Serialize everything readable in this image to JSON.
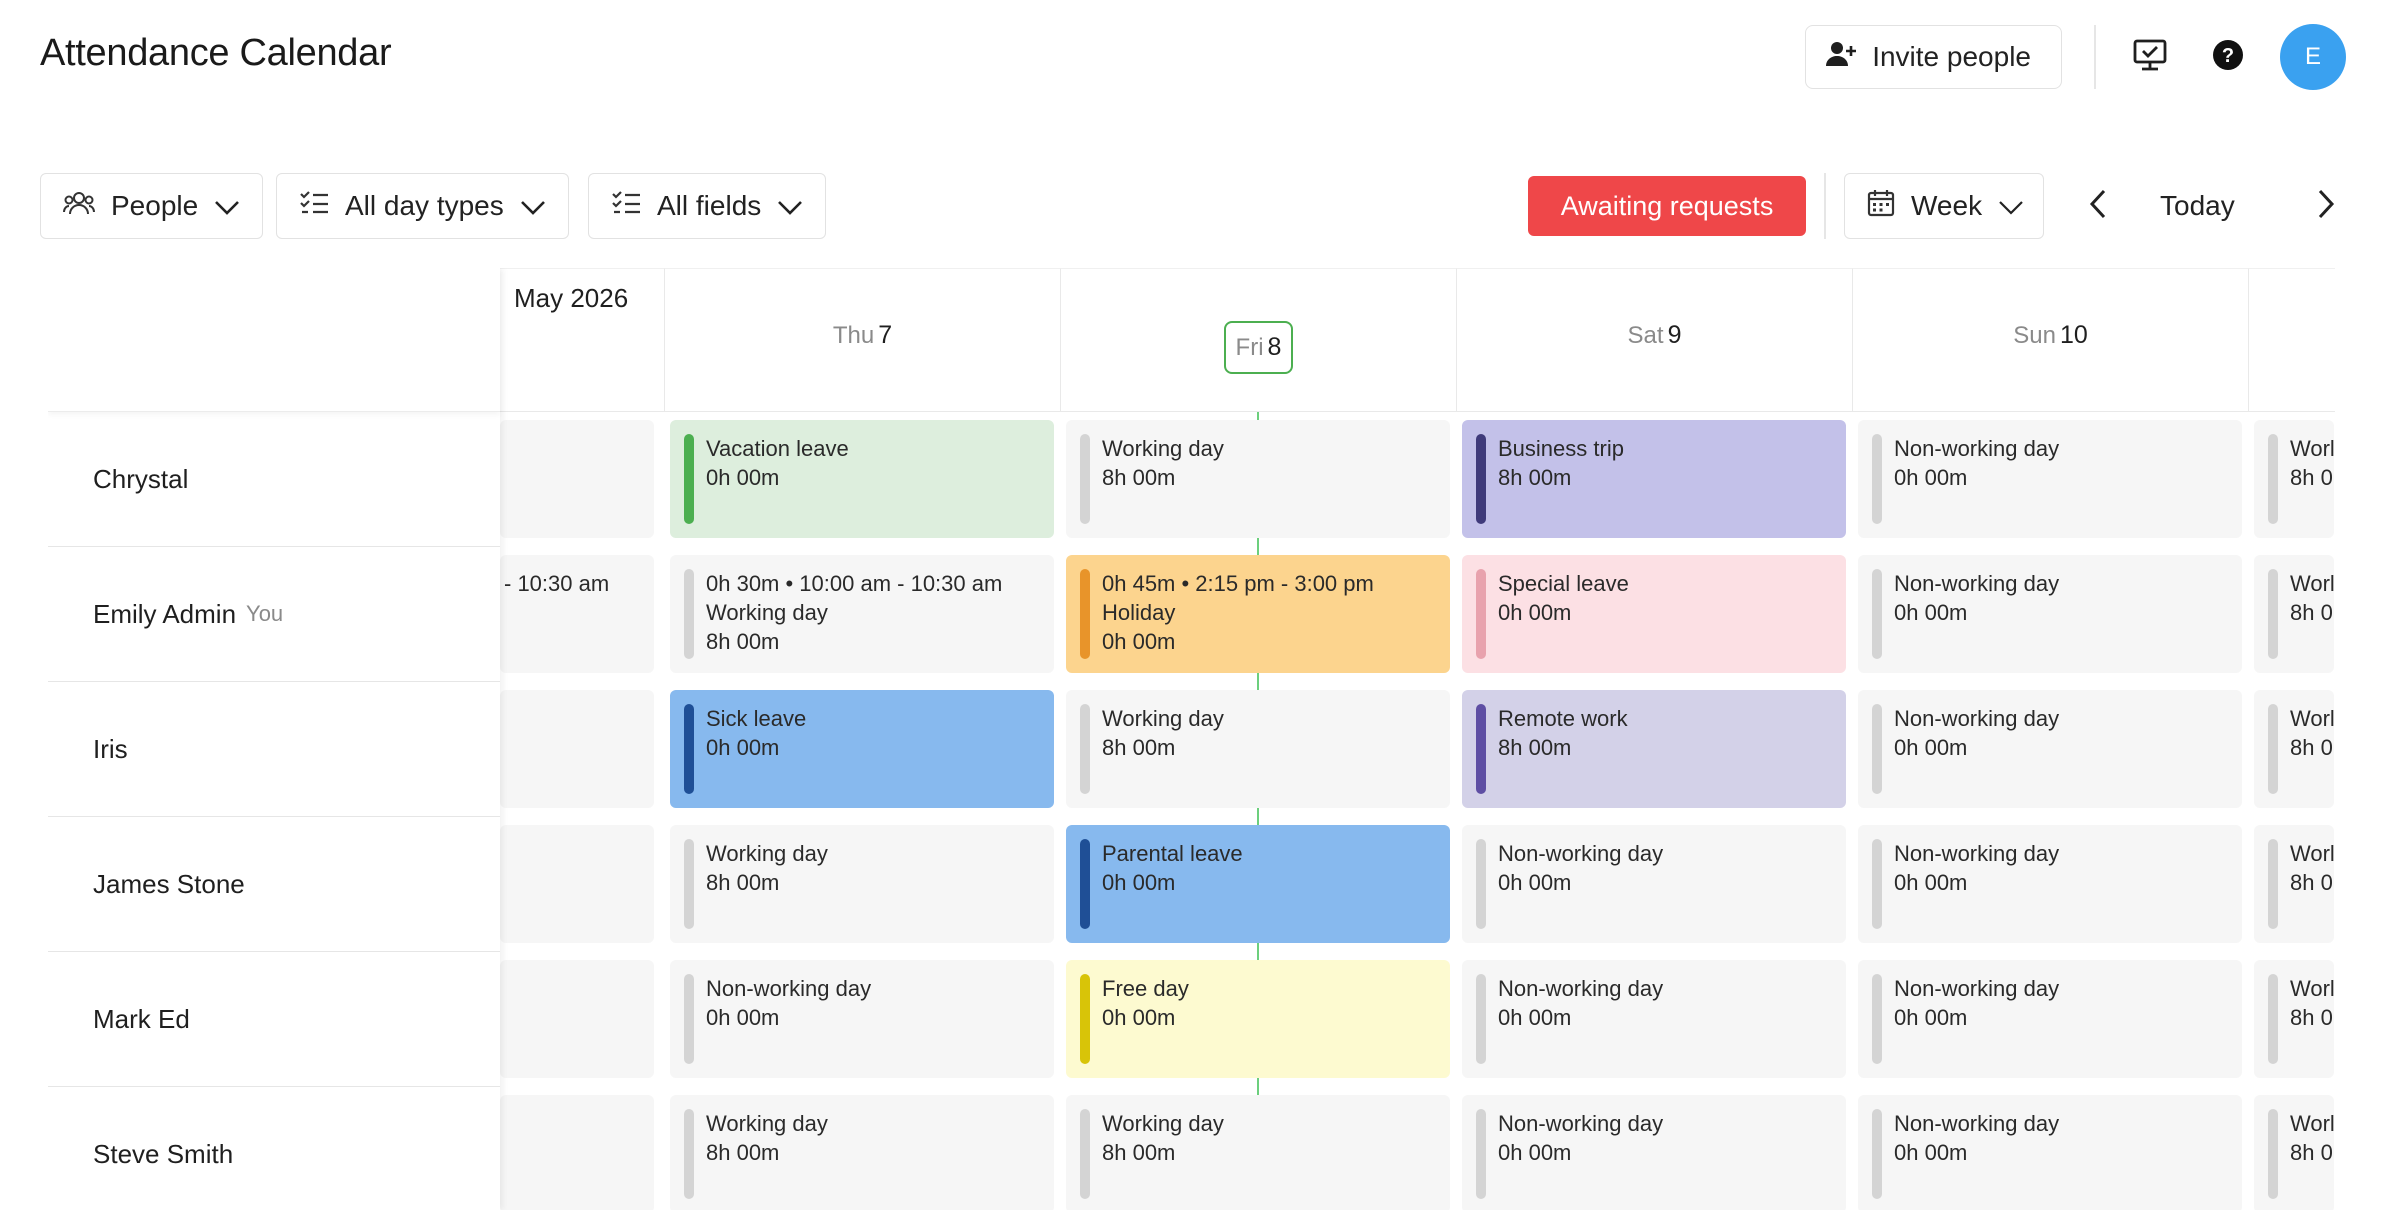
{
  "header": {
    "title": "Attendance Calendar",
    "invite_label": "Invite people",
    "avatar_initial": "E"
  },
  "toolbar": {
    "people_label": "People",
    "day_types_label": "All day types",
    "fields_label": "All fields",
    "awaiting_label": "Awaiting requests",
    "view_label": "Week",
    "today_label": "Today"
  },
  "calendar": {
    "month_label": "May 2026",
    "days": [
      {
        "dow": "Thu",
        "num": "7"
      },
      {
        "dow": "Fri",
        "num": "8"
      },
      {
        "dow": "Sat",
        "num": "9"
      },
      {
        "dow": "Sun",
        "num": "10"
      }
    ],
    "people": [
      {
        "name": "Chrystal",
        "tag": ""
      },
      {
        "name": "Emily Admin",
        "tag": "You"
      },
      {
        "name": "Iris",
        "tag": ""
      },
      {
        "name": "James Stone",
        "tag": ""
      },
      {
        "name": "Mark Ed",
        "tag": ""
      },
      {
        "name": "Steve Smith",
        "tag": ""
      }
    ],
    "partial_prev": [
      "",
      "- 10:30 am",
      "",
      "",
      "",
      ""
    ],
    "partial_next": [
      "Worl\n8h 0",
      "Worl\n8h 0",
      "Worl\n8h 0",
      "Worl\n8h 0",
      "Worl\n8h 0",
      "Worl\n8h 0"
    ],
    "cells": [
      [
        {
          "lines": [
            "Vacation leave",
            "0h 00m"
          ],
          "bg": "#ddeedd",
          "bar": "#4caf50"
        },
        {
          "lines": [
            "Working day",
            "8h 00m"
          ],
          "bg": "#f6f6f6",
          "bar": "#d4d4d4"
        },
        {
          "lines": [
            "Business trip",
            "8h 00m"
          ],
          "bg": "#c3c1e9",
          "bar": "#3f3a7a"
        },
        {
          "lines": [
            "Non-working day",
            "0h 00m"
          ],
          "bg": "#f6f6f6",
          "bar": "#d4d4d4"
        }
      ],
      [
        {
          "lines": [
            "0h 30m • 10:00 am - 10:30 am",
            "Working day",
            "8h 00m"
          ],
          "bg": "#f6f6f6",
          "bar": "#d4d4d4"
        },
        {
          "lines": [
            "0h 45m • 2:15 pm - 3:00 pm",
            "Holiday",
            "0h 00m"
          ],
          "bg": "#fcd48e",
          "bar": "#e8942a"
        },
        {
          "lines": [
            "Special leave",
            "0h 00m"
          ],
          "bg": "#fce0e4",
          "bar": "#e8a2ad"
        },
        {
          "lines": [
            "Non-working day",
            "0h 00m"
          ],
          "bg": "#f6f6f6",
          "bar": "#d4d4d4"
        }
      ],
      [
        {
          "lines": [
            "Sick leave",
            "0h 00m"
          ],
          "bg": "#87b9ee",
          "bar": "#1f4f96"
        },
        {
          "lines": [
            "Working day",
            "8h 00m"
          ],
          "bg": "#f6f6f6",
          "bar": "#d4d4d4"
        },
        {
          "lines": [
            "Remote work",
            "8h 00m"
          ],
          "bg": "#d3d1e8",
          "bar": "#5e4ea3"
        },
        {
          "lines": [
            "Non-working day",
            "0h 00m"
          ],
          "bg": "#f6f6f6",
          "bar": "#d4d4d4"
        }
      ],
      [
        {
          "lines": [
            "Working day",
            "8h 00m"
          ],
          "bg": "#f6f6f6",
          "bar": "#d4d4d4"
        },
        {
          "lines": [
            "Parental leave",
            "0h 00m"
          ],
          "bg": "#87b9ee",
          "bar": "#1f4f96"
        },
        {
          "lines": [
            "Non-working day",
            "0h 00m"
          ],
          "bg": "#f6f6f6",
          "bar": "#d4d4d4"
        },
        {
          "lines": [
            "Non-working day",
            "0h 00m"
          ],
          "bg": "#f6f6f6",
          "bar": "#d4d4d4"
        }
      ],
      [
        {
          "lines": [
            "Non-working day",
            "0h 00m"
          ],
          "bg": "#f6f6f6",
          "bar": "#d4d4d4"
        },
        {
          "lines": [
            "Free day",
            "0h 00m"
          ],
          "bg": "#fdfad0",
          "bar": "#d8c408"
        },
        {
          "lines": [
            "Non-working day",
            "0h 00m"
          ],
          "bg": "#f6f6f6",
          "bar": "#d4d4d4"
        },
        {
          "lines": [
            "Non-working day",
            "0h 00m"
          ],
          "bg": "#f6f6f6",
          "bar": "#d4d4d4"
        }
      ],
      [
        {
          "lines": [
            "Working day",
            "8h 00m"
          ],
          "bg": "#f6f6f6",
          "bar": "#d4d4d4"
        },
        {
          "lines": [
            "Working day",
            "8h 00m"
          ],
          "bg": "#f6f6f6",
          "bar": "#d4d4d4"
        },
        {
          "lines": [
            "Non-working day",
            "0h 00m"
          ],
          "bg": "#f6f6f6",
          "bar": "#d4d4d4"
        },
        {
          "lines": [
            "Non-working day",
            "0h 00m"
          ],
          "bg": "#f6f6f6",
          "bar": "#d4d4d4"
        }
      ]
    ]
  }
}
